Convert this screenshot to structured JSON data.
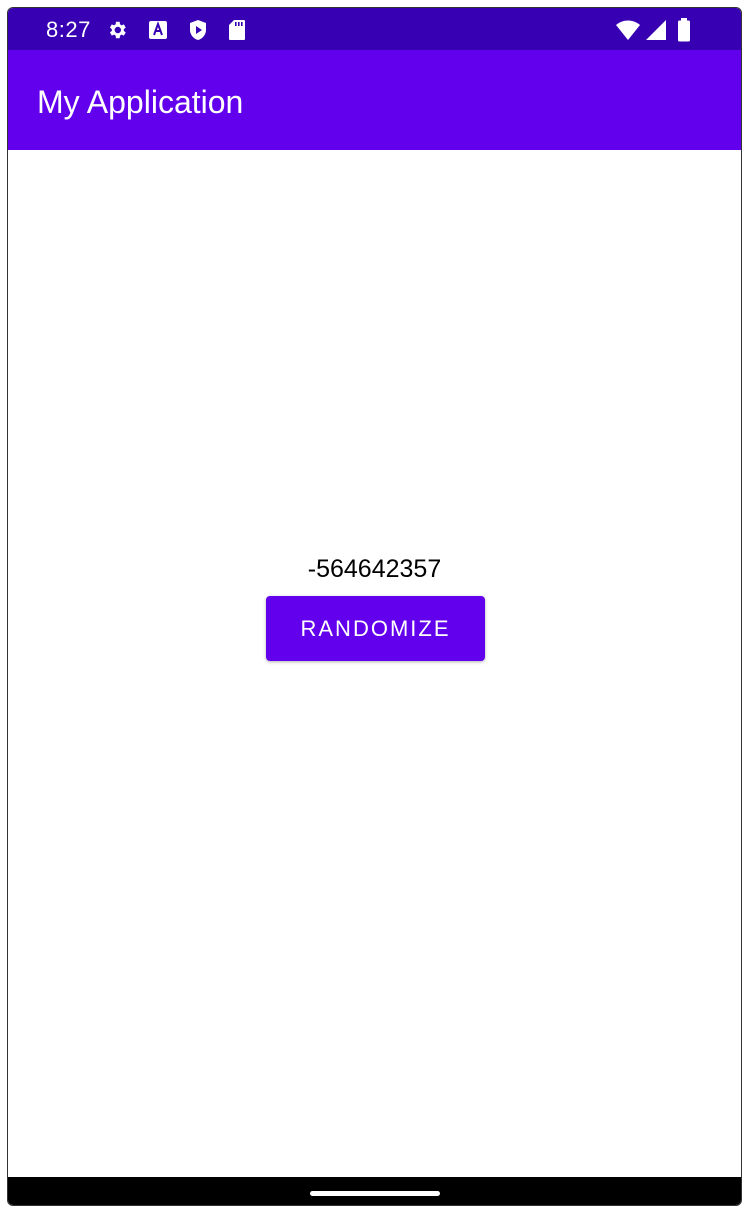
{
  "status_bar": {
    "time": "8:27",
    "left_icons": [
      "settings-icon",
      "accessibility-a-icon",
      "play-protect-icon",
      "sd-card-icon"
    ],
    "right_icons": [
      "wifi-icon",
      "cellular-signal-icon",
      "battery-icon"
    ],
    "color": "#3700b3"
  },
  "app_bar": {
    "title": "My Application",
    "color": "#6200ee"
  },
  "main": {
    "number": "-564642357",
    "button_label": "RANDOMIZE",
    "accent_color": "#6200ee"
  },
  "nav_bar": {
    "handle": "home-handle"
  }
}
